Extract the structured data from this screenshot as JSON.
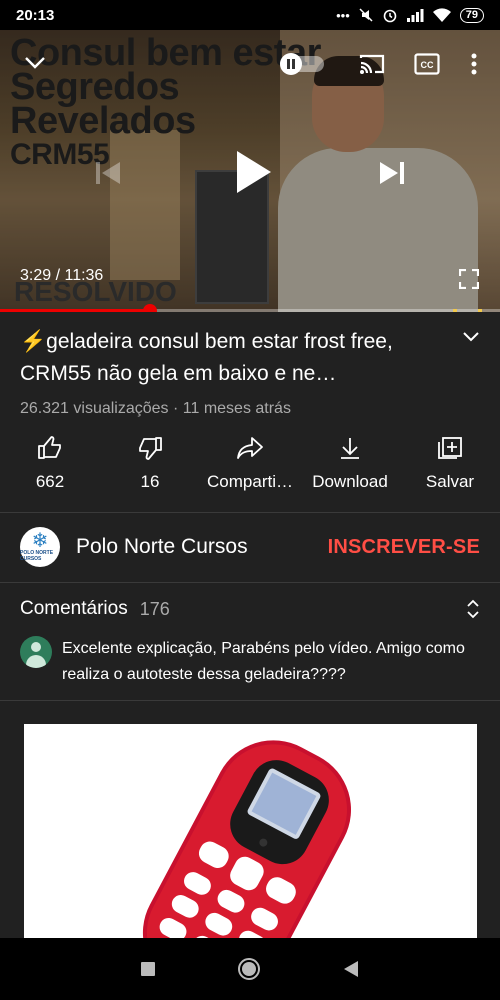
{
  "status_bar": {
    "time": "20:13",
    "icons": [
      "more-dots-icon",
      "mute-icon",
      "alarm-icon",
      "signal-icon",
      "wifi-icon"
    ],
    "battery": "79"
  },
  "player": {
    "thumbnail_lines": [
      "Consul bem estar",
      "Segredos",
      "Revelados",
      "CRM55"
    ],
    "thumbnail_bottom": "RESOLVIDO",
    "time": "3:29 / 11:36",
    "progress_fraction": 0.3,
    "chapter_fractions": [
      0.905,
      0.955
    ],
    "colors": {
      "progress": "#ee0000",
      "chapter": "#f2c94c"
    }
  },
  "video": {
    "title": "⚡geladeira consul bem estar frost free, CRM55 não gela em baixo e ne…",
    "meta": "26.321 visualizações · 11 meses atrás"
  },
  "actions": {
    "like": "662",
    "dislike": "16",
    "share": "Comparti…",
    "download": "Download",
    "save": "Salvar"
  },
  "channel": {
    "name": "Polo Norte Cursos",
    "avatar_text": "POLO NORTE CURSOS",
    "subscribe": "INSCREVER-SE",
    "subscribe_color": "#ff4e45"
  },
  "comments": {
    "title": "Comentários",
    "count": "176",
    "first_comment": "Excelente explicação, Parabéns pelo vídeo. Amigo como realiza o autoteste dessa geladeira????"
  }
}
